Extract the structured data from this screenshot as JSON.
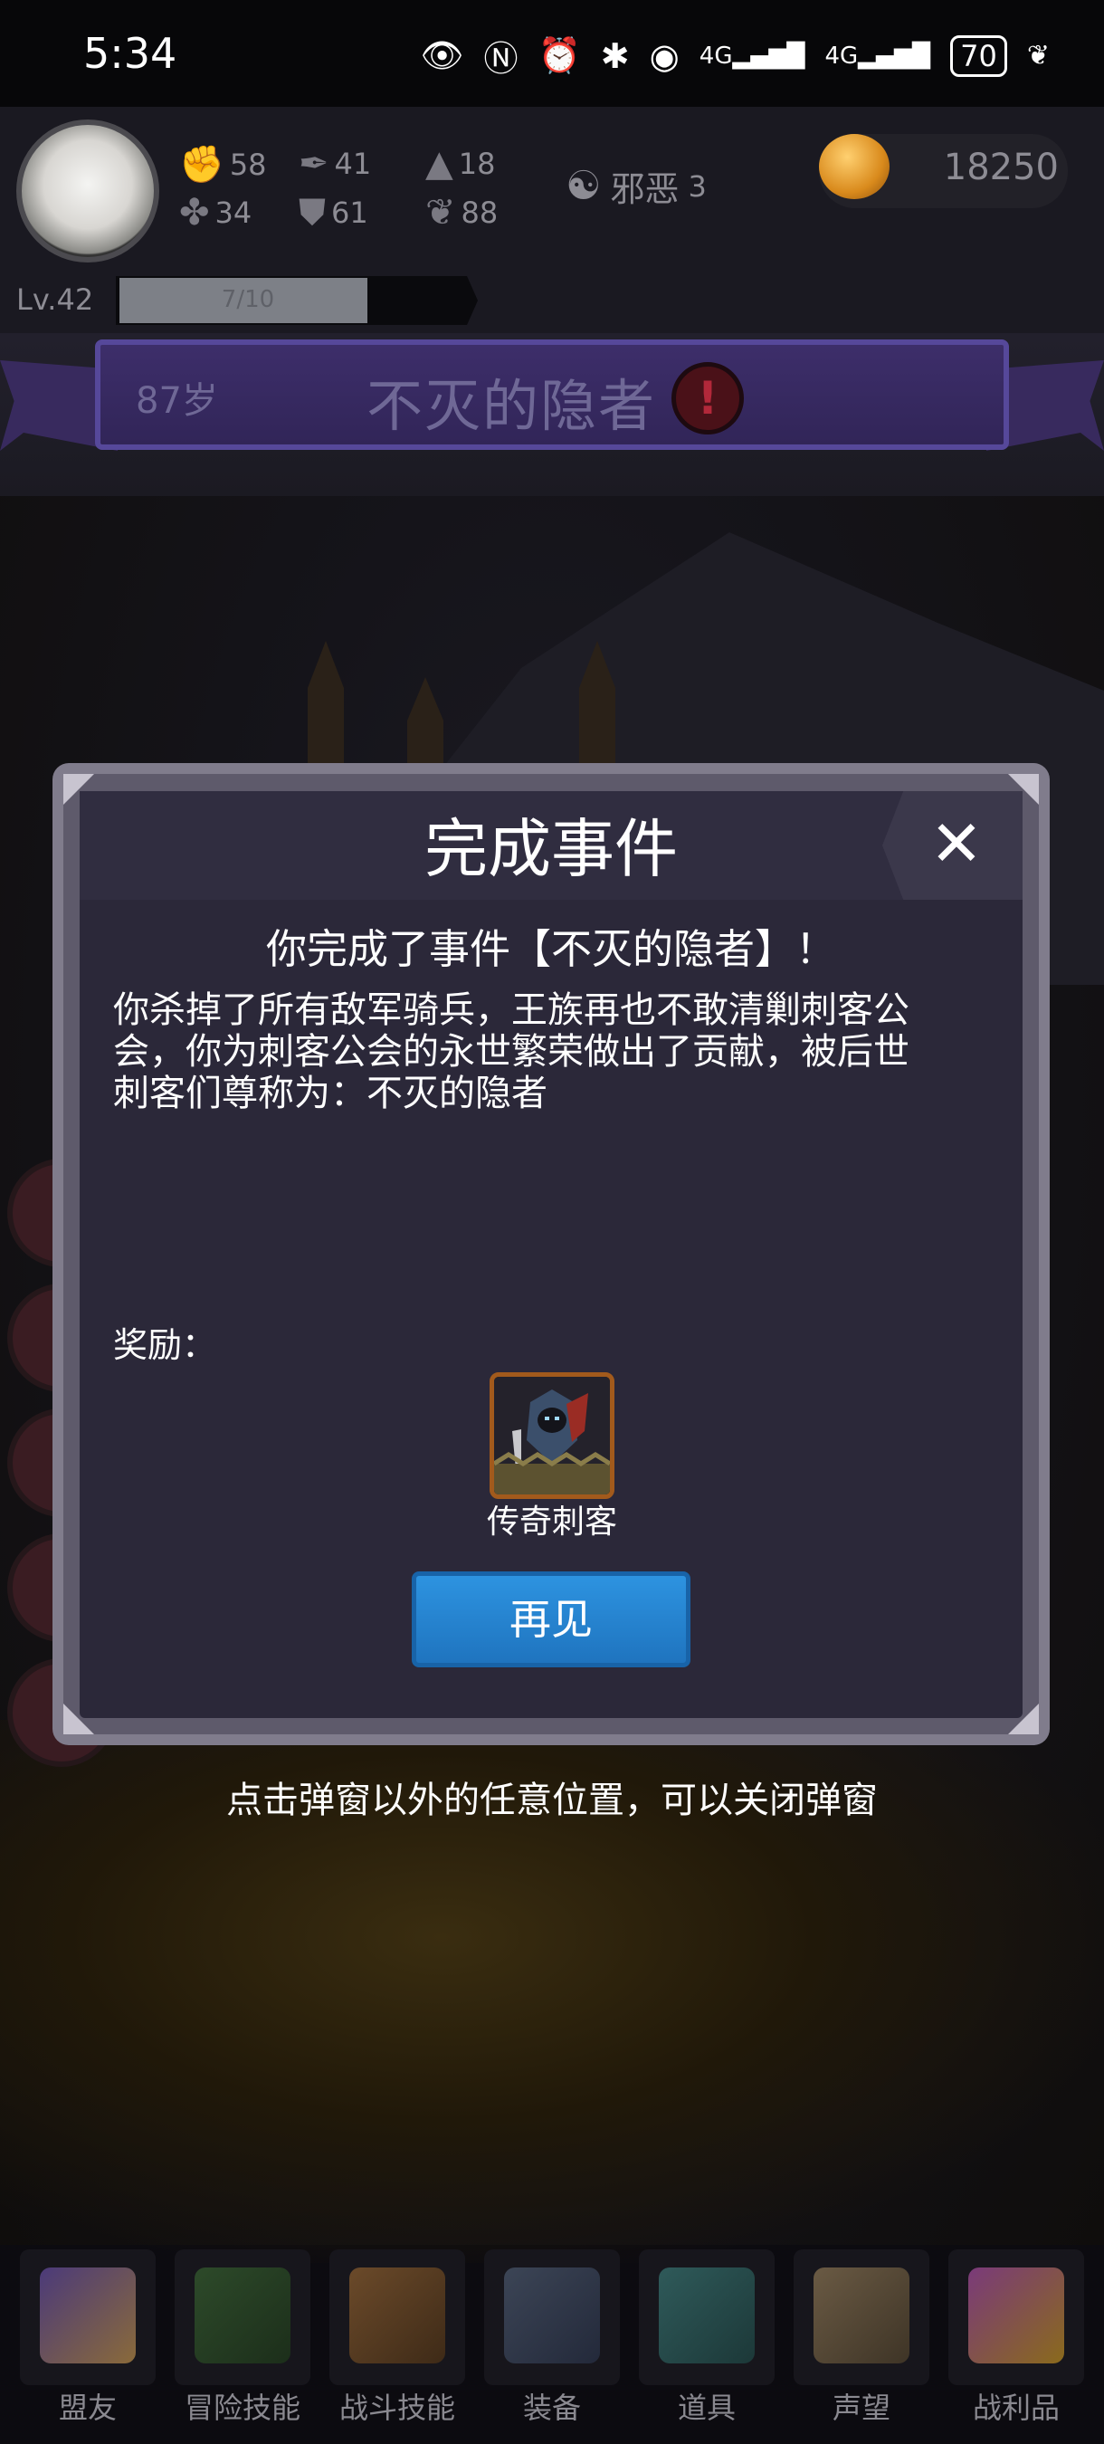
{
  "status_bar": {
    "time": "5:34",
    "icons": [
      "eye-icon",
      "nfc-icon",
      "alarm-icon",
      "bluetooth-icon",
      "hotspot-icon",
      "signal-4g-icon",
      "signal-4g-icon"
    ],
    "battery": "70"
  },
  "player": {
    "stats": [
      {
        "icon": "fist-icon",
        "value": "58"
      },
      {
        "icon": "clover-icon",
        "value": "34"
      },
      {
        "icon": "feather-icon",
        "value": "41"
      },
      {
        "icon": "shield-icon",
        "value": "61"
      },
      {
        "icon": "wizard-hat-icon",
        "value": "18"
      },
      {
        "icon": "wing-icon",
        "value": "88"
      }
    ],
    "alignment_label": "邪恶",
    "alignment_value": "3",
    "gold": "18250",
    "level": "Lv.42",
    "xp_text": "7/10",
    "xp_fraction": 0.7
  },
  "banner": {
    "age": "87岁",
    "title": "不灭的隐者"
  },
  "modal": {
    "title": "完成事件",
    "completion_text": "你完成了事件【不灭的隐者】！",
    "description_lines": [
      "你杀掉了所有敌军骑兵，王族再也不敢清剿刺客公",
      "会，你为刺客公会的永世繁荣做出了贡献，被后世",
      "刺客们尊称为：不灭的隐者"
    ],
    "reward_label": "奖励：",
    "reward_item_name": "传奇刺客",
    "button_label": "再见"
  },
  "hint": "点击弹窗以外的任意位置，可以关闭弹窗",
  "bottom_nav": [
    {
      "label": "盟友",
      "icon": "handshake-icon"
    },
    {
      "label": "冒险技能",
      "icon": "spellbook-icon"
    },
    {
      "label": "战斗技能",
      "icon": "backpack-icon"
    },
    {
      "label": "装备",
      "icon": "crossed-swords-icon"
    },
    {
      "label": "道具",
      "icon": "satchel-icon"
    },
    {
      "label": "声望",
      "icon": "scroll-icon"
    },
    {
      "label": "战利品",
      "icon": "treasure-chest-icon"
    }
  ],
  "colors": {
    "banner_purple": "#3d2e6a",
    "button_blue": "#2d93e0",
    "modal_bg": "#2b2839"
  }
}
